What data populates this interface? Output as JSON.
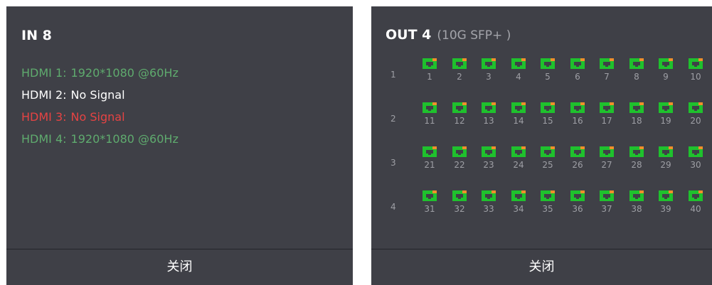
{
  "colors": {
    "panel_bg": "#3f4047",
    "ok_green": "#5fab6e",
    "error_red": "#e64343",
    "neutral_white": "#ffffff",
    "port_green": "#1fc12d",
    "port_orange": "#f0902b",
    "muted_gray": "#9e9fa5"
  },
  "input_panel": {
    "title": "IN 8",
    "hdmi": [
      {
        "label": "HDMI 1:",
        "value": "1920*1080 @60Hz",
        "status": "ok"
      },
      {
        "label": "HDMI 2:",
        "value": "No Signal",
        "status": "neutral"
      },
      {
        "label": "HDMI 3:",
        "value": "No Signal",
        "status": "error"
      },
      {
        "label": "HDMI 4:",
        "value": "1920*1080 @60Hz",
        "status": "ok"
      }
    ],
    "close_label": "关闭"
  },
  "output_panel": {
    "title": "OUT 4",
    "subtitle": "(10G SFP+ )",
    "rows": [
      {
        "label": "1",
        "ports": [
          "1",
          "2",
          "3",
          "4",
          "5",
          "6",
          "7",
          "8",
          "9",
          "10"
        ]
      },
      {
        "label": "2",
        "ports": [
          "11",
          "12",
          "13",
          "14",
          "15",
          "16",
          "17",
          "18",
          "19",
          "20"
        ]
      },
      {
        "label": "3",
        "ports": [
          "21",
          "22",
          "23",
          "24",
          "25",
          "26",
          "27",
          "28",
          "29",
          "30"
        ]
      },
      {
        "label": "4",
        "ports": [
          "31",
          "32",
          "33",
          "34",
          "35",
          "36",
          "37",
          "38",
          "39",
          "40"
        ]
      }
    ],
    "port_icon": "ethernet-port-icon",
    "close_label": "关闭"
  }
}
